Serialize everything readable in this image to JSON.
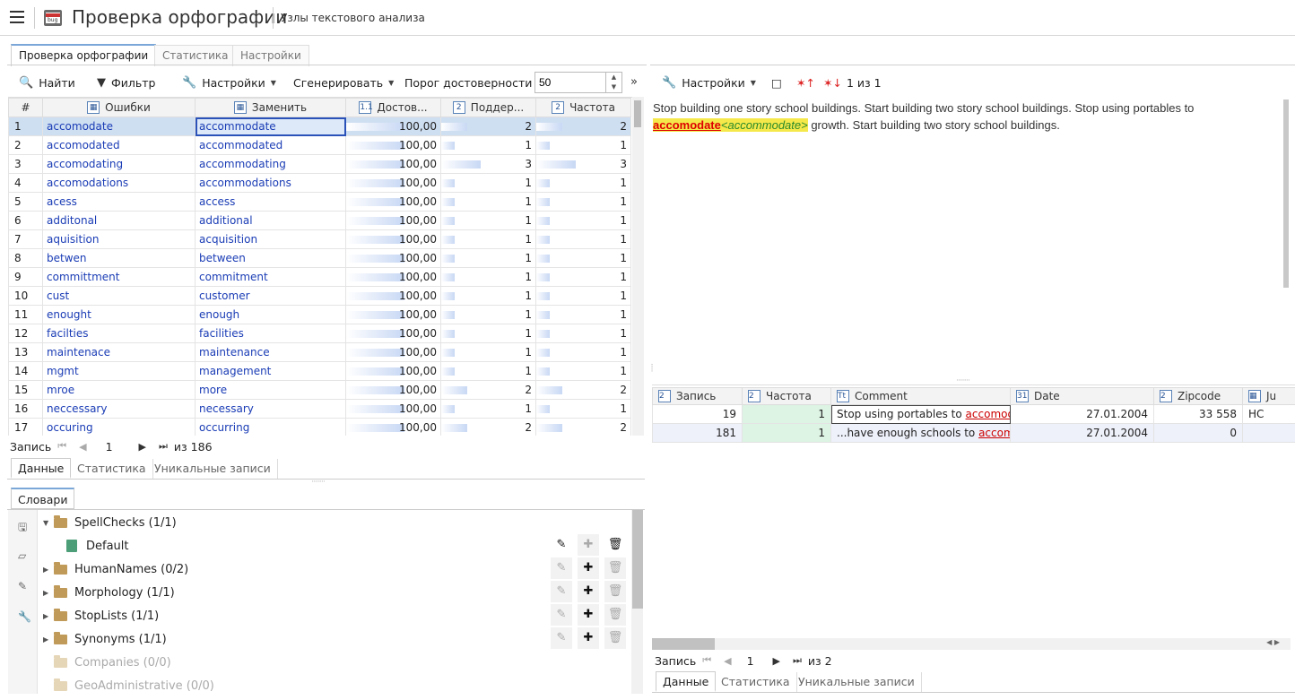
{
  "header": {
    "app_title": "Проверка орфографии",
    "subtitle": "Узлы текстового анализа",
    "logo_text": "bug"
  },
  "top_tabs": [
    "Проверка орфографии",
    "Статистика",
    "Настройки"
  ],
  "left_toolbar": {
    "find": "Найти",
    "filter": "Фильтр",
    "settings": "Настройки",
    "generate": "Сгенерировать",
    "threshold_label": "Порог достоверности",
    "threshold_value": "50"
  },
  "grid": {
    "columns": [
      "#",
      "Ошибки",
      "Заменить",
      "Достов...",
      "Поддер...",
      "Частота"
    ],
    "rows": [
      {
        "n": "1",
        "err": "accomodate",
        "rep": "accommodate",
        "rel": "100,00",
        "sup": "2",
        "freq": "2"
      },
      {
        "n": "2",
        "err": "accomodated",
        "rep": "accommodated",
        "rel": "100,00",
        "sup": "1",
        "freq": "1"
      },
      {
        "n": "3",
        "err": "accomodating",
        "rep": "accommodating",
        "rel": "100,00",
        "sup": "3",
        "freq": "3"
      },
      {
        "n": "4",
        "err": "accomodations",
        "rep": "accommodations",
        "rel": "100,00",
        "sup": "1",
        "freq": "1"
      },
      {
        "n": "5",
        "err": "acess",
        "rep": "access",
        "rel": "100,00",
        "sup": "1",
        "freq": "1"
      },
      {
        "n": "6",
        "err": "additonal",
        "rep": "additional",
        "rel": "100,00",
        "sup": "1",
        "freq": "1"
      },
      {
        "n": "7",
        "err": "aquisition",
        "rep": "acquisition",
        "rel": "100,00",
        "sup": "1",
        "freq": "1"
      },
      {
        "n": "8",
        "err": "betwen",
        "rep": "between",
        "rel": "100,00",
        "sup": "1",
        "freq": "1"
      },
      {
        "n": "9",
        "err": "committment",
        "rep": "commitment",
        "rel": "100,00",
        "sup": "1",
        "freq": "1"
      },
      {
        "n": "10",
        "err": "cust",
        "rep": "customer",
        "rel": "100,00",
        "sup": "1",
        "freq": "1"
      },
      {
        "n": "11",
        "err": "enought",
        "rep": "enough",
        "rel": "100,00",
        "sup": "1",
        "freq": "1"
      },
      {
        "n": "12",
        "err": "facilties",
        "rep": "facilities",
        "rel": "100,00",
        "sup": "1",
        "freq": "1"
      },
      {
        "n": "13",
        "err": "maintenace",
        "rep": "maintenance",
        "rel": "100,00",
        "sup": "1",
        "freq": "1"
      },
      {
        "n": "14",
        "err": "mgmt",
        "rep": "management",
        "rel": "100,00",
        "sup": "1",
        "freq": "1"
      },
      {
        "n": "15",
        "err": "mroe",
        "rep": "more",
        "rel": "100,00",
        "sup": "2",
        "freq": "2"
      },
      {
        "n": "16",
        "err": "neccessary",
        "rep": "necessary",
        "rel": "100,00",
        "sup": "1",
        "freq": "1"
      },
      {
        "n": "17",
        "err": "occuring",
        "rep": "occurring",
        "rel": "100,00",
        "sup": "2",
        "freq": "2"
      }
    ]
  },
  "left_pager": {
    "label": "Запись",
    "current": "1",
    "total": "из 186"
  },
  "left_subtabs": [
    "Данные",
    "Статистика",
    "Уникальные записи"
  ],
  "dictionaries": {
    "tab": "Словари",
    "items": [
      {
        "label": "SpellChecks (1/1)",
        "expanded": true
      },
      {
        "label": "Default",
        "child": true
      },
      {
        "label": "HumanNames (0/2)"
      },
      {
        "label": "Morphology (1/1)"
      },
      {
        "label": "StopLists (1/1)"
      },
      {
        "label": "Synonyms (1/1)"
      },
      {
        "label": "Companies (0/0)",
        "disabled": true
      },
      {
        "label": "GeoAdministrative (0/0)",
        "disabled": true
      }
    ]
  },
  "right_toolbar": {
    "settings": "Настройки",
    "counter": "1 из 1"
  },
  "text_view": {
    "line1": "Stop building one story school buildings. Start building two story school buildings. Stop using portables to",
    "misspelled": "accomodate",
    "suggestion": "<accommodate>",
    "line2_rest": " growth. Start building two story school buildings."
  },
  "records_grid": {
    "columns": [
      "Запись",
      "Частота",
      "Comment",
      "Date",
      "Zipcode",
      "Ju"
    ],
    "rows": [
      {
        "rec": "19",
        "freq": "1",
        "comment_pre": "Stop using portables to ",
        "comment_err": "accomodat",
        "date": "27.01.2004",
        "zip": "33 558",
        "ju": "HC"
      },
      {
        "rec": "181",
        "freq": "1",
        "comment_pre": "...have enough schools to ",
        "comment_err": "accomoc",
        "date": "27.01.2004",
        "zip": "0",
        "ju": ""
      }
    ]
  },
  "right_pager": {
    "label": "Запись",
    "current": "1",
    "total": "из 2"
  },
  "right_subtabs": [
    "Данные",
    "Статистика",
    "Уникальные записи"
  ]
}
